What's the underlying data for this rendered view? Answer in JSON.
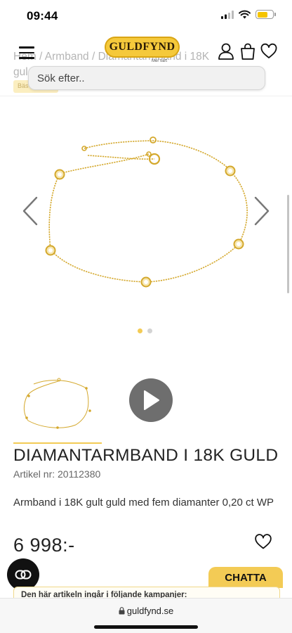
{
  "status": {
    "time": "09:44"
  },
  "header": {
    "breadcrumb": "Hem / Armband / Diamantarmband i 18K",
    "breadcrumb_line2": "gul",
    "badge_partial": "Bäs",
    "logo_text": "GULDFYND",
    "logo_subtext": "Mer värt",
    "search_placeholder": "Sök efter.."
  },
  "gallery": {
    "image_count": 2,
    "active_index": 0
  },
  "product": {
    "title": "DIAMANTARMBAND I 18K GULD",
    "article_number": "Artikel nr: 20112380",
    "description": "Armband i 18K gult guld med fem diamanter 0,20 ct WP",
    "price": "6 998:-"
  },
  "chat": {
    "label": "CHATTA"
  },
  "campaign": {
    "text": "Den här artikeln ingår i följande kampanjer:"
  },
  "browser": {
    "url": "guldfynd.se"
  },
  "colors": {
    "accent": "#f3cb55",
    "gold_chain": "#d4a82c",
    "dark": "#111111"
  },
  "icons": [
    "menu-icon",
    "user-icon",
    "bag-icon",
    "heart-icon",
    "chevron-left-icon",
    "chevron-right-icon",
    "play-icon",
    "chat-icon",
    "lock-icon"
  ]
}
